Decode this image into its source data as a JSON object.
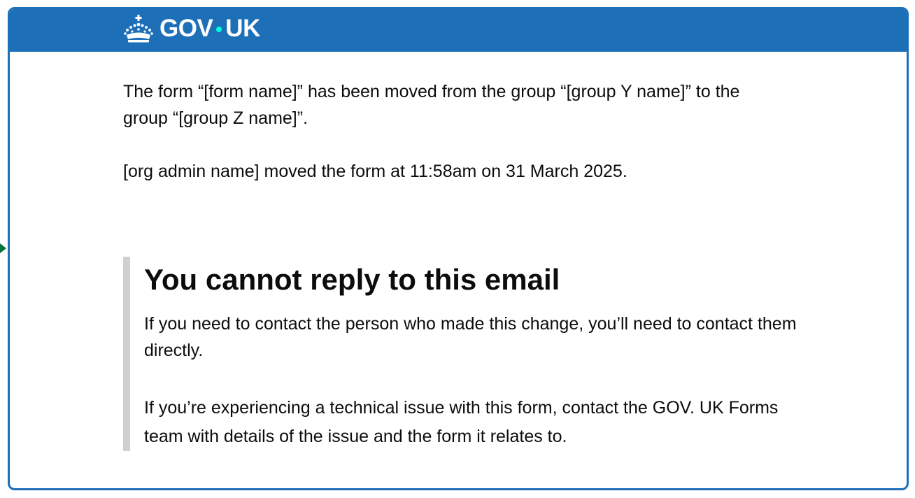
{
  "header": {
    "logo_text_left": "GOV",
    "logo_text_right": "UK",
    "logo_icon": "crown-icon",
    "background_color": "#1d70b8",
    "dot_color": "#00ffe0"
  },
  "email": {
    "paragraph_1": "The form “[form name]” has been moved from the group “[group Y name]” to the group “[group Z name]”.",
    "paragraph_2": "[org admin name] moved the form at 11:58am on 31 March 2025."
  },
  "inset": {
    "heading": "You cannot reply to this email",
    "paragraph_1": "If you need to contact the person who made this change, you’ll need to contact them directly.",
    "paragraph_2": "If you’re experiencing a technical issue with this form, contact the GOV. UK Forms team with details of the issue and the form it relates to.",
    "border_color": "#d0d0d0"
  },
  "side_marker": {
    "icon": "triangle-right-icon",
    "color": "#00703c"
  }
}
